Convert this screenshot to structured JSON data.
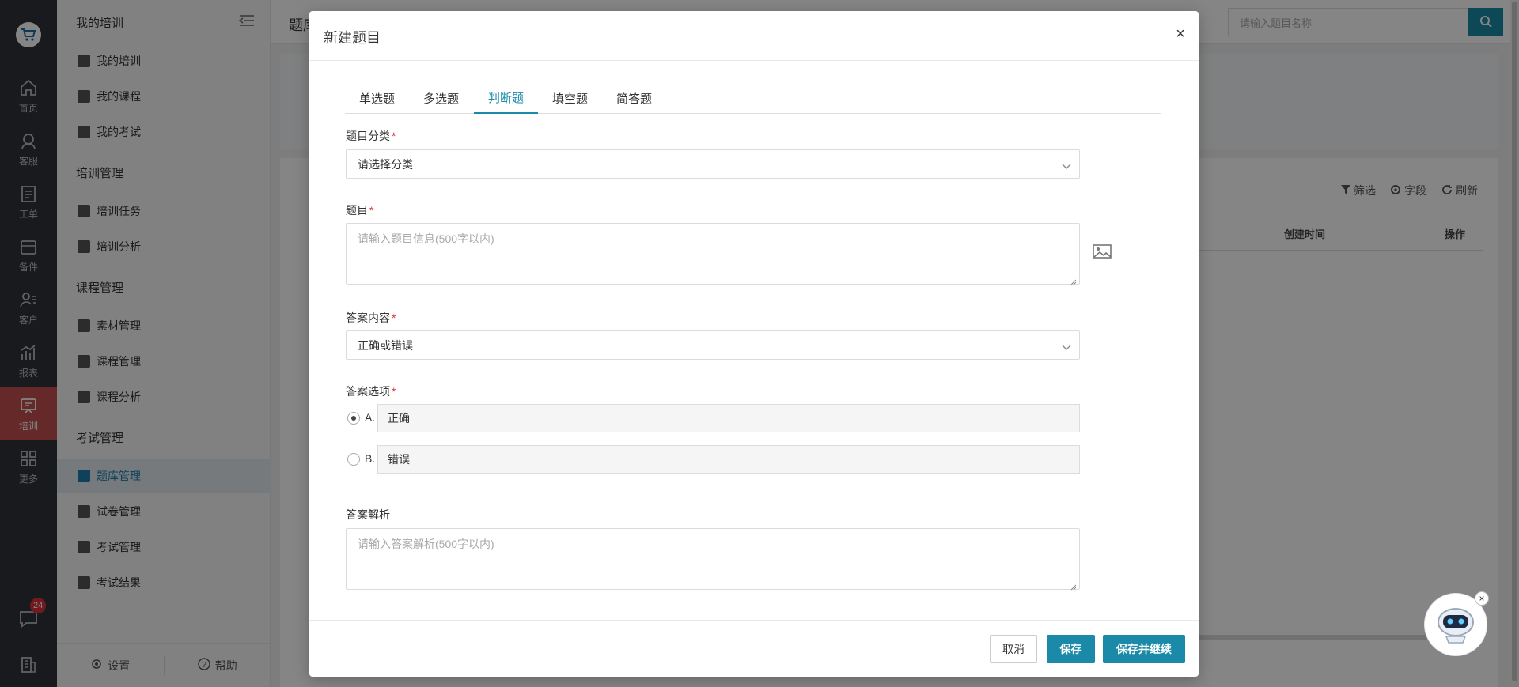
{
  "rail": {
    "items": [
      {
        "label": "首页",
        "icon": "home-icon"
      },
      {
        "label": "客服",
        "icon": "headset-icon"
      },
      {
        "label": "工单",
        "icon": "clipboard-icon"
      },
      {
        "label": "备件",
        "icon": "box-icon"
      },
      {
        "label": "客户",
        "icon": "user-list-icon"
      },
      {
        "label": "报表",
        "icon": "chart-icon"
      },
      {
        "label": "培训",
        "icon": "training-icon",
        "active": true
      },
      {
        "label": "更多",
        "icon": "grid-icon"
      }
    ],
    "chat_badge": "24"
  },
  "sidebar": {
    "section1": "我的培训",
    "my_training": [
      "我的培训",
      "我的课程",
      "我的考试"
    ],
    "section2": "培训管理",
    "training_mgmt": [
      "培训任务",
      "培训分析"
    ],
    "section3": "课程管理",
    "course_mgmt": [
      "素材管理",
      "课程管理",
      "课程分析"
    ],
    "section4": "考试管理",
    "exam_mgmt": [
      "题库管理",
      "试卷管理",
      "考试管理",
      "考试结果"
    ],
    "settings": "设置",
    "help": "帮助"
  },
  "background": {
    "crumb": "题库",
    "search_placeholder": "请输入题目名称",
    "filter": "筛选",
    "fields": "字段",
    "refresh": "刷新",
    "col_created": "创建时间",
    "col_ops": "操作"
  },
  "modal": {
    "title": "新建题目",
    "tabs": [
      "单选题",
      "多选题",
      "判断题",
      "填空题",
      "简答题"
    ],
    "active_tab": "判断题",
    "category_label": "题目分类",
    "category_value": "请选择分类",
    "question_label": "题目",
    "question_placeholder": "请输入题目信息(500字以内)",
    "answer_content_label": "答案内容",
    "answer_content_value": "正确或错误",
    "options_label": "答案选项",
    "options": [
      {
        "letter": "A.",
        "value": "正确",
        "selected": true
      },
      {
        "letter": "B.",
        "value": "错误",
        "selected": false
      }
    ],
    "analysis_label": "答案解析",
    "analysis_placeholder": "请输入答案解析(500字以内)",
    "cancel": "取消",
    "save": "保存",
    "save_continue": "保存并继续",
    "required_mark": "*"
  },
  "colors": {
    "accent": "#1a8aa8",
    "rail_bg": "#2f3338",
    "rail_active": "#c0504d",
    "required": "#d9313a"
  }
}
